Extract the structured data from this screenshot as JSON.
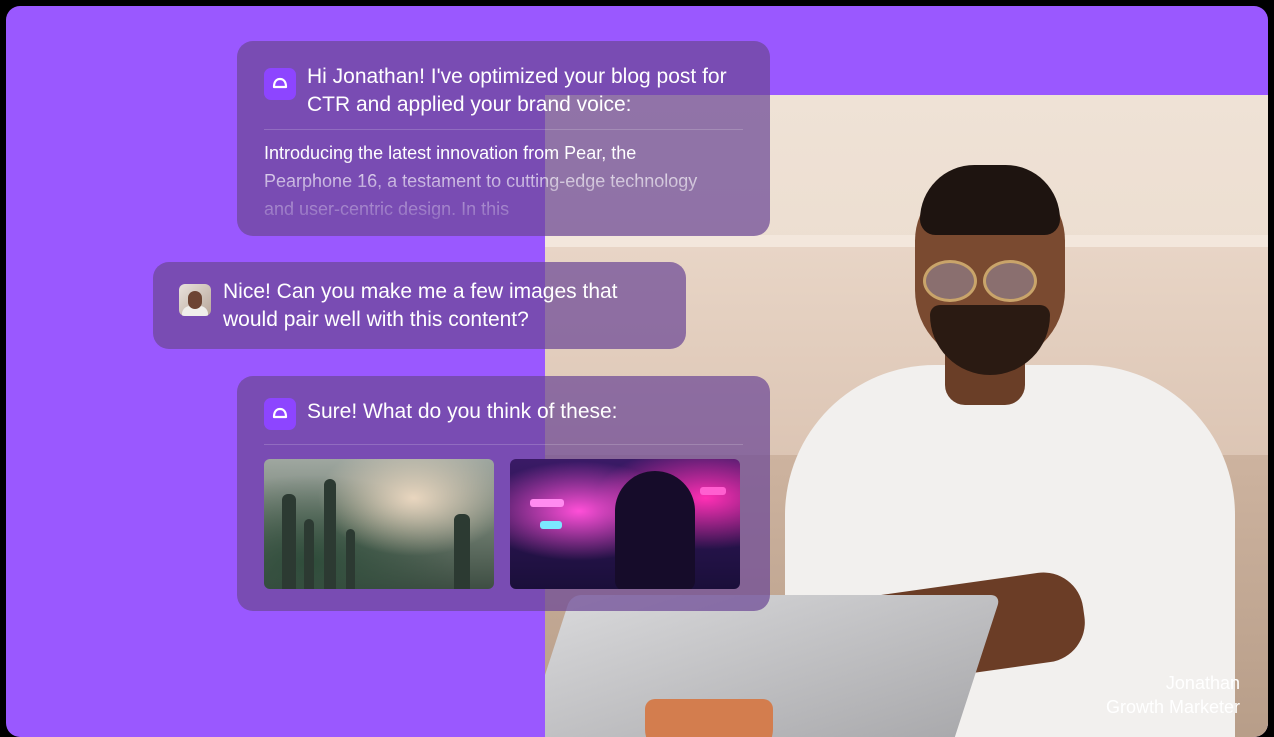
{
  "colors": {
    "background": "#9a58ff",
    "bubble": "#6c4896",
    "ai_icon": "#8d45ff"
  },
  "messages": {
    "ai_1": {
      "icon": "assistant-logo-icon",
      "title": "Hi Jonathan! I've optimized your blog post for CTR and applied your brand voice:",
      "preview": "Introducing the latest innovation from Pear, the Pearphone 16, a testament to cutting-edge technology and user-centric design. In this"
    },
    "user_1": {
      "icon": "user-avatar",
      "text": "Nice! Can you make me a few images that would pair well with this content?"
    },
    "ai_2": {
      "icon": "assistant-logo-icon",
      "title": "Sure! What do you think of these:",
      "images": [
        {
          "name": "fantasy-landscape-image"
        },
        {
          "name": "neon-city-portrait-image"
        }
      ]
    }
  },
  "caption": {
    "name": "Jonathan",
    "role": "Growth Marketer"
  }
}
